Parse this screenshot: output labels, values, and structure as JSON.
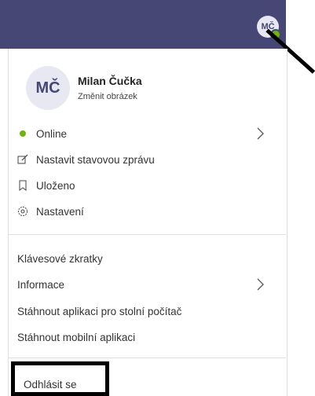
{
  "header": {
    "avatar_initials": "MČ"
  },
  "profile": {
    "initials": "MČ",
    "name": "Milan Čučka",
    "change_picture": "Změnit obrázek"
  },
  "status_menu": [
    {
      "label": "Online",
      "icon": "green-dot",
      "has_submenu": true
    },
    {
      "label": "Nastavit stavovou zprávu",
      "icon": "edit-message-icon"
    },
    {
      "label": "Uloženo",
      "icon": "bookmark-icon"
    },
    {
      "label": "Nastavení",
      "icon": "gear-icon"
    }
  ],
  "secondary_menu": [
    {
      "label": "Klávesové zkratky"
    },
    {
      "label": "Informace",
      "has_submenu": true
    },
    {
      "label": "Stáhnout aplikaci pro stolní počítač"
    },
    {
      "label": "Stáhnout mobilní aplikaci"
    }
  ],
  "logout": {
    "label": "Odhlásit se"
  },
  "colors": {
    "header": "#464775",
    "presence": "#6bb700"
  }
}
